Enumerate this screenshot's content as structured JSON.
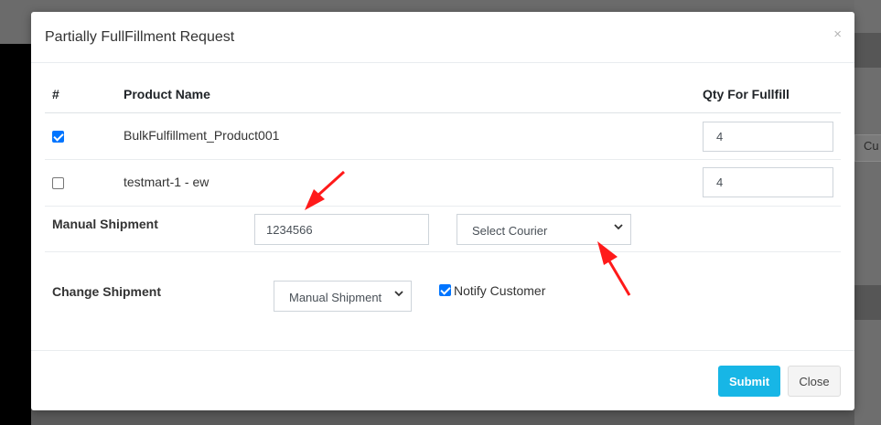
{
  "background": {
    "fragment": "Cu"
  },
  "modal": {
    "title": "Partially FullFillment Request",
    "close_glyph": "×"
  },
  "table": {
    "headers": {
      "index": "#",
      "product_name": "Product Name",
      "qty": "Qty For Fullfill"
    },
    "rows": [
      {
        "checked": true,
        "product": "BulkFulfillment_Product001",
        "qty": "4"
      },
      {
        "checked": false,
        "product": "testmart-1 - ew",
        "qty": "4"
      }
    ]
  },
  "manual_shipment": {
    "label": "Manual Shipment",
    "tracking_value": "1234566",
    "courier_select": "Select Courier"
  },
  "change_shipment": {
    "label": "Change Shipment",
    "select_value": "Manual Shipment",
    "notify_checked": true,
    "notify_label": "Notify Customer"
  },
  "footer": {
    "submit_label": "Submit",
    "close_label": "Close"
  },
  "colors": {
    "accent": "#17b6e6",
    "checkbox": "#0075ff",
    "arrow": "#ff1a1a"
  }
}
